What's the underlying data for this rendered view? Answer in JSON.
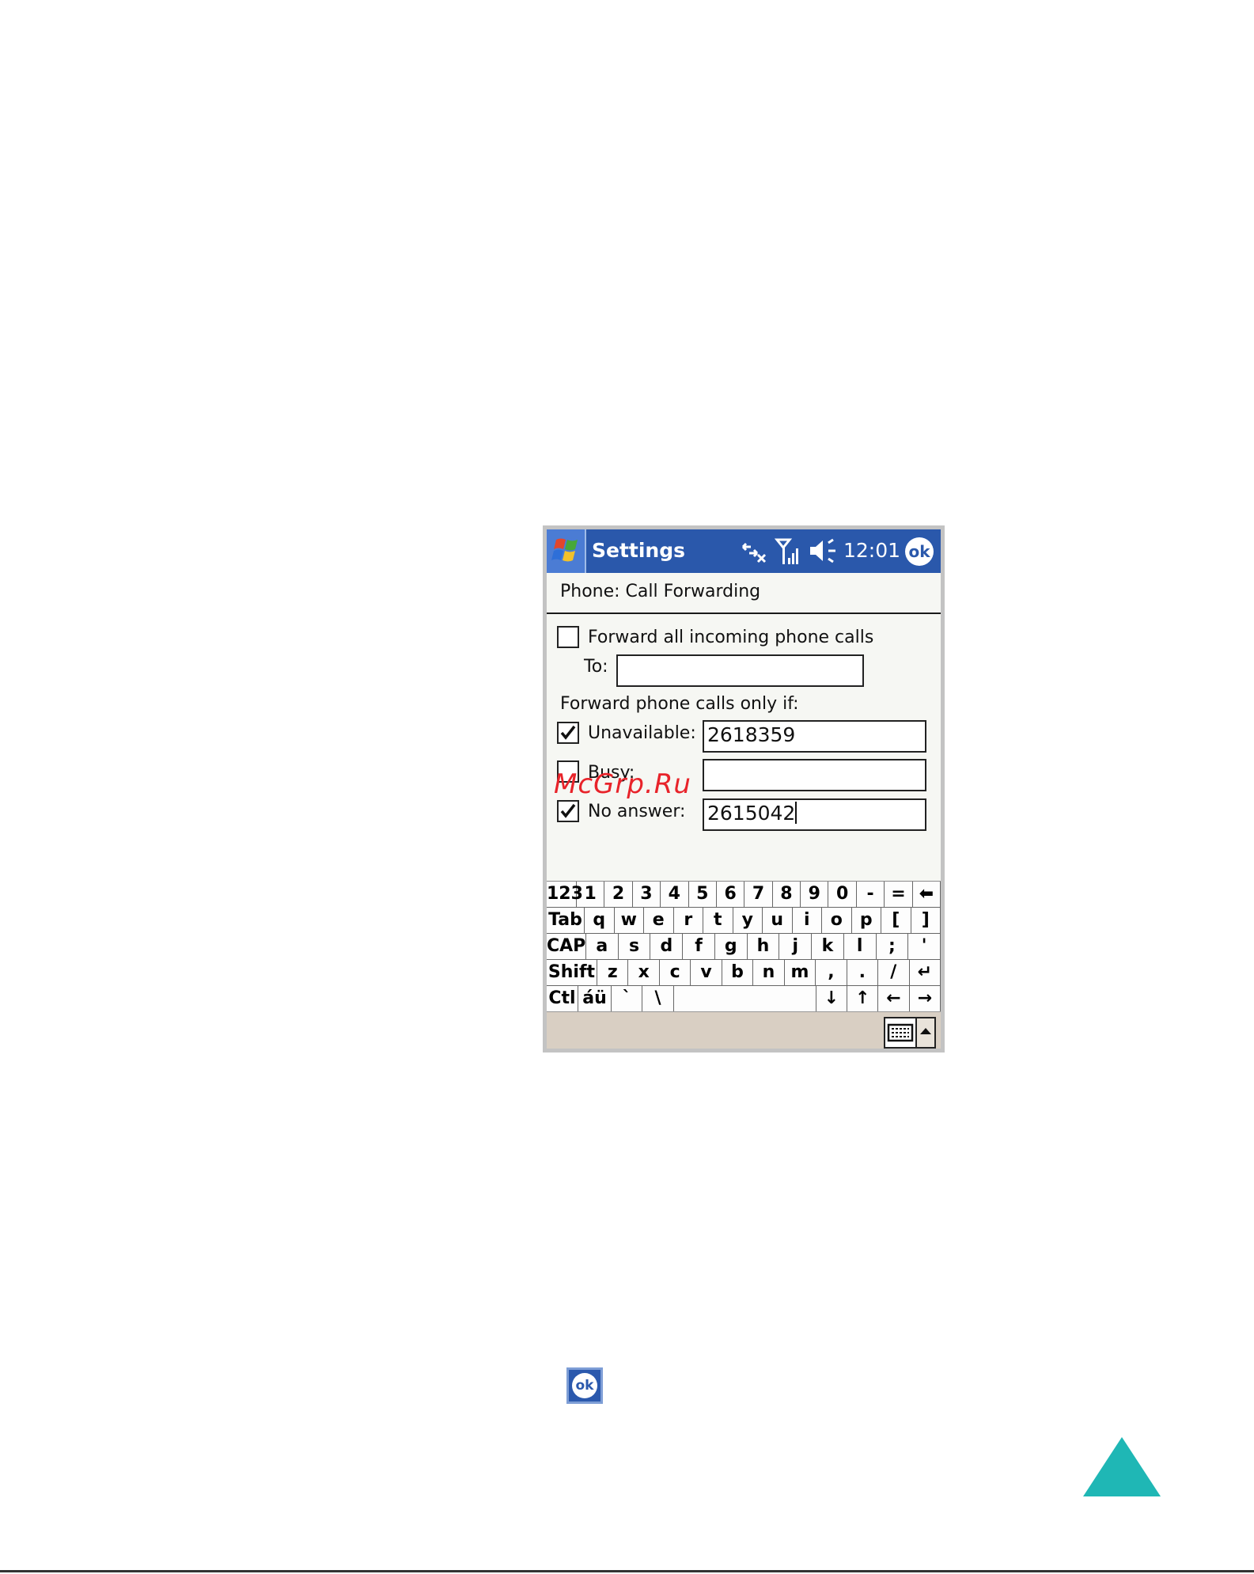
{
  "titlebar": {
    "title": "Settings",
    "clock": "12:01",
    "ok_label": "ok",
    "icons": [
      "windows-start-icon",
      "connectivity-icon",
      "signal-strength-icon",
      "speaker-icon"
    ]
  },
  "form": {
    "heading": "Phone: Call Forwarding",
    "forward_all": {
      "label": "Forward all incoming phone calls",
      "checked": false
    },
    "to_label": "To:",
    "to_value": "",
    "only_if_label": "Forward phone calls only if:",
    "unavailable": {
      "label": "Unavailable:",
      "checked": true,
      "value": "2618359"
    },
    "busy": {
      "label": "Busy:",
      "checked": false,
      "value": ""
    },
    "no_answer": {
      "label": "No answer:",
      "checked": true,
      "value": "2615042"
    }
  },
  "keyboard": {
    "rows": [
      [
        "123",
        "1",
        "2",
        "3",
        "4",
        "5",
        "6",
        "7",
        "8",
        "9",
        "0",
        "-",
        "=",
        "⬅"
      ],
      [
        "Tab",
        "q",
        "w",
        "e",
        "r",
        "t",
        "y",
        "u",
        "i",
        "o",
        "p",
        "[",
        "]"
      ],
      [
        "CAP",
        "a",
        "s",
        "d",
        "f",
        "g",
        "h",
        "j",
        "k",
        "l",
        ";",
        "'"
      ],
      [
        "Shift",
        "z",
        "x",
        "c",
        "v",
        "b",
        "n",
        "m",
        ",",
        ".",
        "/",
        "↵"
      ],
      [
        "Ctl",
        "áü",
        "`",
        "\\",
        " ",
        "↓",
        "↑",
        "←",
        "→"
      ]
    ]
  },
  "watermark": "McGrp.Ru",
  "ok_icon_label": "ok",
  "colors": {
    "titlebar": "#2a58ab",
    "screen_bg": "#f6f7f3",
    "taskbar": "#d9cfc3",
    "triangle": "#1fb7b5",
    "watermark": "#e8232a"
  }
}
